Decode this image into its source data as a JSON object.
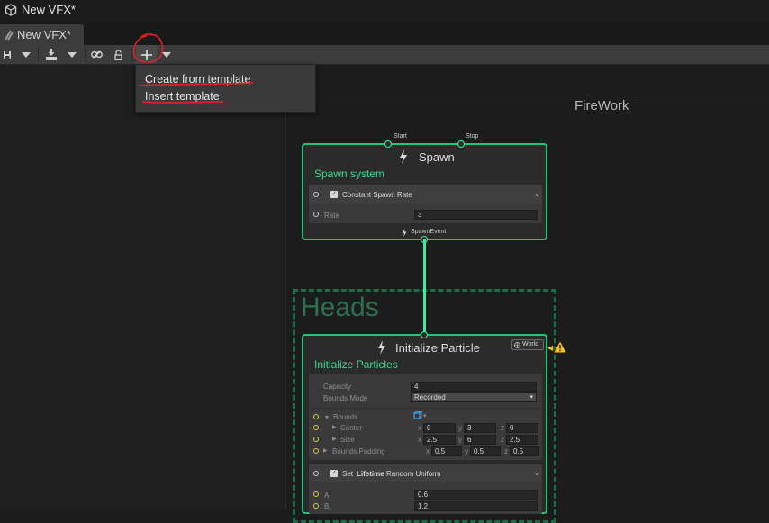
{
  "window": {
    "title": "New VFX*"
  },
  "tab": {
    "label": "New VFX*"
  },
  "toolbar": {
    "save_icon": "save-icon",
    "export_icon": "download-icon",
    "link_icon": "link-icon",
    "lock_icon": "lock-icon",
    "add_icon": "plus-icon"
  },
  "menu": {
    "items": [
      {
        "label": "Create from template"
      },
      {
        "label": "Insert template"
      }
    ]
  },
  "graph": {
    "system_name": "FireWork",
    "spawn": {
      "title": "Spawn",
      "subtitle": "Spawn system",
      "port_start": "Start",
      "port_stop": "Stop",
      "block": {
        "label": "Constant Spawn Rate",
        "param": "Rate",
        "value": "3"
      },
      "event": "SpawnEvent"
    },
    "heads": {
      "title": "Heads"
    },
    "init": {
      "title": "Initialize Particle",
      "badge": "World",
      "subtitle": "Initialize Particles",
      "capacity_label": "Capacity",
      "capacity_value": "4",
      "bounds_mode_label": "Bounds Mode",
      "bounds_mode_value": "Recorded",
      "bounds_label": "Bounds",
      "center_label": "Center",
      "center": {
        "x": "0",
        "y": "3",
        "z": "0"
      },
      "size_label": "Size",
      "size": {
        "x": "2.5",
        "y": "6",
        "z": "2.5"
      },
      "padding_label": "Bounds Padding",
      "padding": {
        "x": "0.5",
        "y": "0.5",
        "z": "0.5"
      },
      "set_block": {
        "set": "Set",
        "attr": "Lifetime",
        "mode": "Random Uniform",
        "a_label": "A",
        "a_value": "0.6",
        "b_label": "B",
        "b_value": "1.2"
      }
    }
  },
  "colors": {
    "accent": "#23c37a",
    "edge": "#3ee9a0",
    "annotation": "#e0202a",
    "warning": "#f0c020"
  }
}
